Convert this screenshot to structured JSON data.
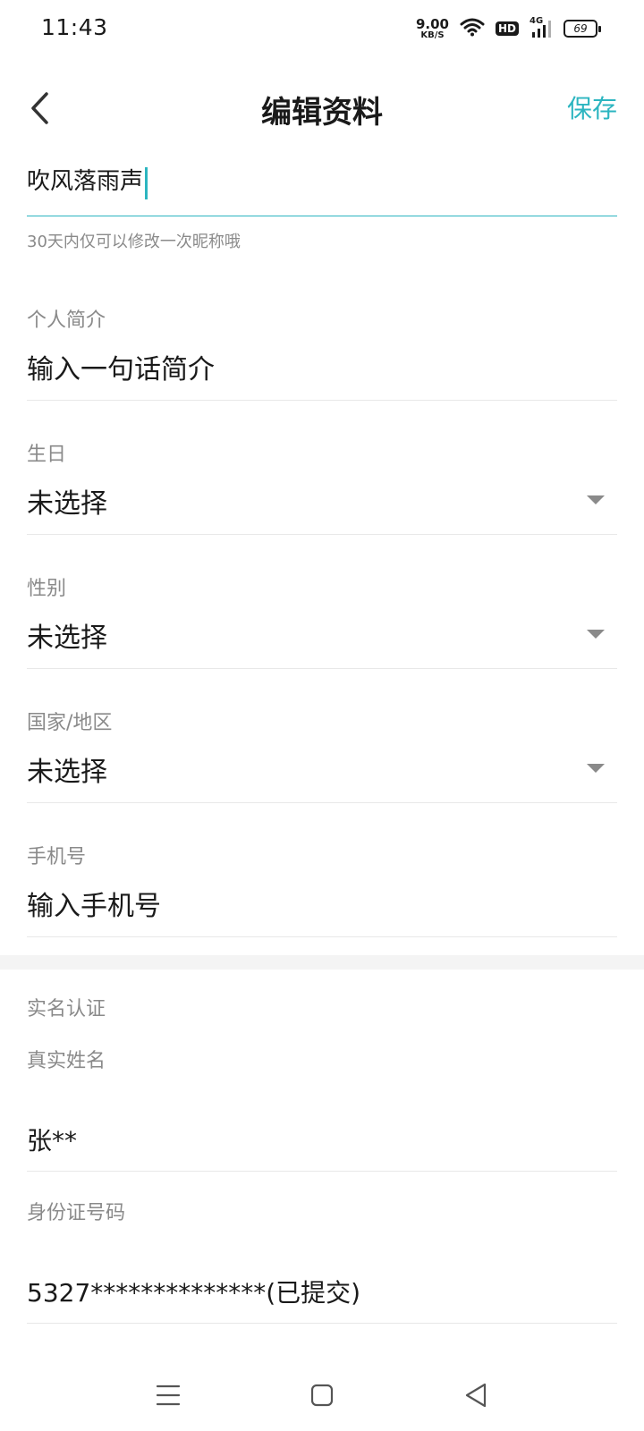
{
  "status_bar": {
    "time": "11:43",
    "net_speed_value": "9.00",
    "net_speed_unit": "KB/S",
    "hd_label": "HD",
    "network_label": "4G",
    "battery": "69"
  },
  "header": {
    "title": "编辑资料",
    "save_label": "保存"
  },
  "nickname": {
    "value": "吹风落雨声",
    "hint": "30天内仅可以修改一次昵称哦"
  },
  "fields": {
    "bio": {
      "label": "个人简介",
      "placeholder": "输入一句话简介"
    },
    "birthday": {
      "label": "生日",
      "value": "未选择"
    },
    "gender": {
      "label": "性别",
      "value": "未选择"
    },
    "region": {
      "label": "国家/地区",
      "value": "未选择"
    },
    "phone": {
      "label": "手机号",
      "placeholder": "输入手机号"
    }
  },
  "real_name": {
    "section_title": "实名认证",
    "name_label": "真实姓名",
    "name_value": "张**",
    "id_label": "身份证号码",
    "id_value": "5327**************(已提交)"
  },
  "colors": {
    "accent": "#2cb5c0",
    "label_gray": "#8a8a8a",
    "divider": "#e8e8e8"
  }
}
